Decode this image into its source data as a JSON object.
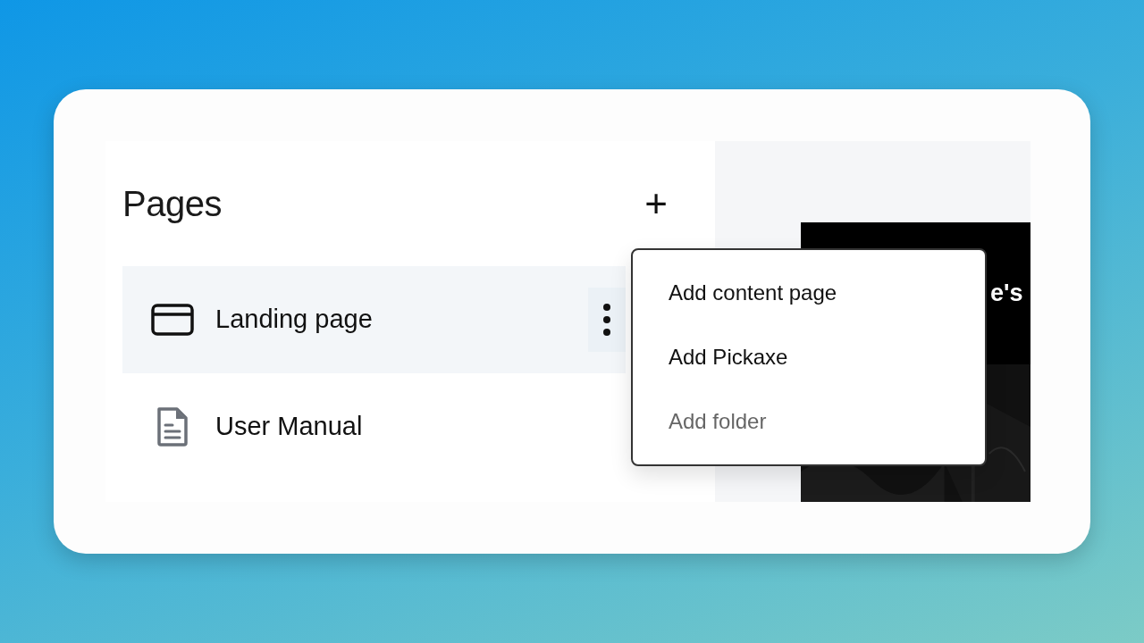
{
  "panel": {
    "title": "Pages",
    "add_button": "+"
  },
  "pages": [
    {
      "label": "Landing page",
      "kind": "landing",
      "selected": true
    },
    {
      "label": "User Manual",
      "kind": "document",
      "selected": false
    }
  ],
  "menu": {
    "items": [
      {
        "label": "Add content page",
        "disabled": false
      },
      {
        "label": "Add Pickaxe",
        "disabled": false
      },
      {
        "label": "Add folder",
        "disabled": true
      }
    ]
  },
  "preview": {
    "heading": "e's"
  }
}
